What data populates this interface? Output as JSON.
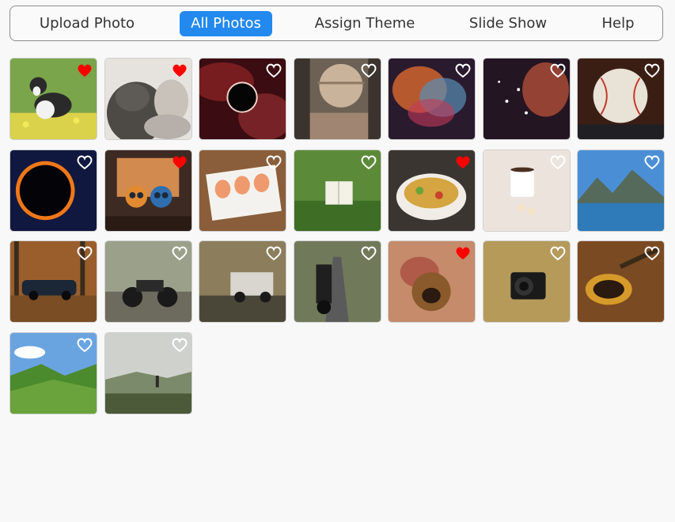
{
  "nav": {
    "items": [
      {
        "label": "Upload Photo",
        "active": false
      },
      {
        "label": "All Photos",
        "active": true
      },
      {
        "label": "Assign Theme",
        "active": false
      },
      {
        "label": "Slide Show",
        "active": false
      },
      {
        "label": "Help",
        "active": false
      }
    ]
  },
  "colors": {
    "accent": "#2389ee",
    "heart_liked": "#ff0000",
    "heart_outline": "#ffffff"
  },
  "photos": [
    {
      "subject": "dog-in-flower-field",
      "liked": true
    },
    {
      "subject": "dog-and-person-bw",
      "liked": true
    },
    {
      "subject": "black-hole-nebula",
      "liked": false
    },
    {
      "subject": "planet-over-canyon",
      "liked": false
    },
    {
      "subject": "colorful-nebula",
      "liked": false
    },
    {
      "subject": "star-cluster-nebula",
      "liked": false
    },
    {
      "subject": "baseball-in-glove",
      "liked": false
    },
    {
      "subject": "solar-eclipse-ring",
      "liked": false
    },
    {
      "subject": "cute-robots-at-laptop",
      "liked": true
    },
    {
      "subject": "sushi-platter",
      "liked": false
    },
    {
      "subject": "book-on-grass",
      "liked": false
    },
    {
      "subject": "food-bowl",
      "liked": true
    },
    {
      "subject": "coffee-mug-on-blanket",
      "liked": false
    },
    {
      "subject": "mountain-lake",
      "liked": false
    },
    {
      "subject": "car-in-autumn-forest",
      "liked": false
    },
    {
      "subject": "motorcycle-on-trail",
      "liked": false
    },
    {
      "subject": "offroad-truck-sunset",
      "liked": false
    },
    {
      "subject": "motorcycle-on-road",
      "liked": false
    },
    {
      "subject": "dog-with-person",
      "liked": true
    },
    {
      "subject": "camera-in-grass",
      "liked": false
    },
    {
      "subject": "bass-guitar-on-wood",
      "liked": false
    },
    {
      "subject": "green-valley-hills",
      "liked": false
    },
    {
      "subject": "hiker-on-hilltop",
      "liked": false
    }
  ]
}
